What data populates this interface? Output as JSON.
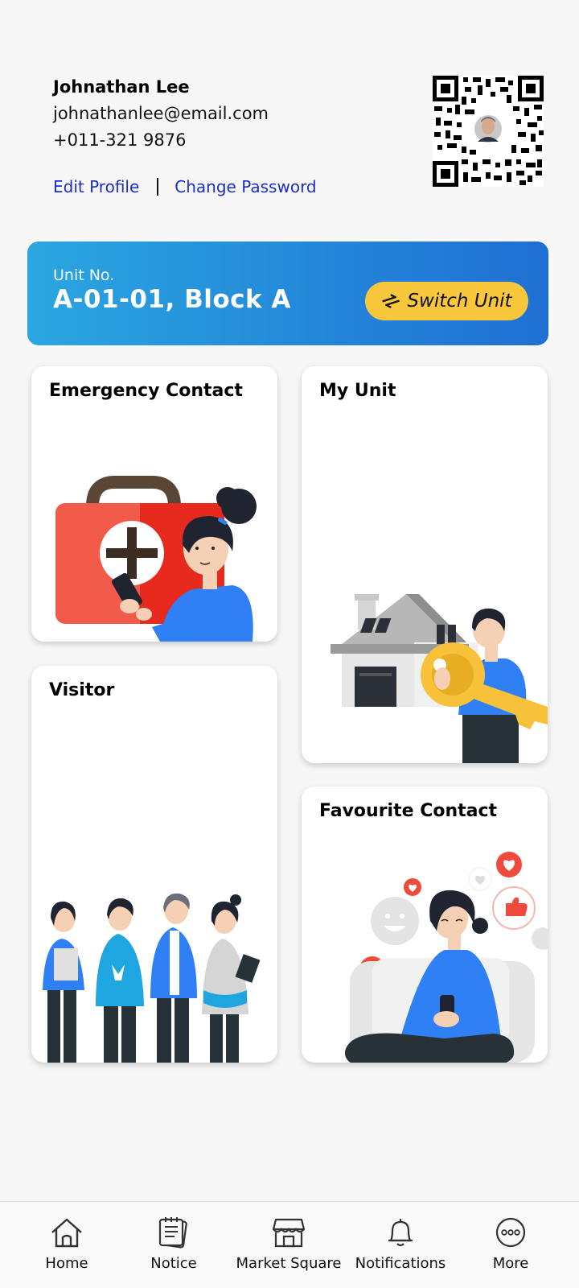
{
  "profile": {
    "name": "Johnathan Lee",
    "email": "johnathanlee@email.com",
    "phone": "+011-321 9876",
    "edit_profile_label": "Edit Profile",
    "change_password_label": "Change Password"
  },
  "qr": {
    "icon": "qr-code-with-avatar"
  },
  "unit": {
    "label": "Unit No.",
    "value": "A-01-01, Block A",
    "switch_label": "Switch Unit",
    "switch_icon": "swap-arrows-icon"
  },
  "cards": {
    "emergency": {
      "title": "Emergency Contact"
    },
    "my_unit": {
      "title": "My Unit"
    },
    "visitor": {
      "title": "Visitor"
    },
    "favourite": {
      "title": "Favourite Contact"
    }
  },
  "nav": {
    "items": [
      {
        "label": "Home",
        "icon": "home-icon"
      },
      {
        "label": "Notice",
        "icon": "notice-icon"
      },
      {
        "label": "Market Square",
        "icon": "store-icon"
      },
      {
        "label": "Notifications",
        "icon": "bell-icon"
      },
      {
        "label": "More",
        "icon": "more-icon"
      }
    ]
  },
  "colors": {
    "banner_start": "#2aa6e0",
    "banner_end": "#1f6fd3",
    "switch_button": "#f9c73b",
    "link": "#1a2fc9",
    "illustration_blue": "#2f80f5",
    "illustration_red": "#ee4b3c"
  }
}
